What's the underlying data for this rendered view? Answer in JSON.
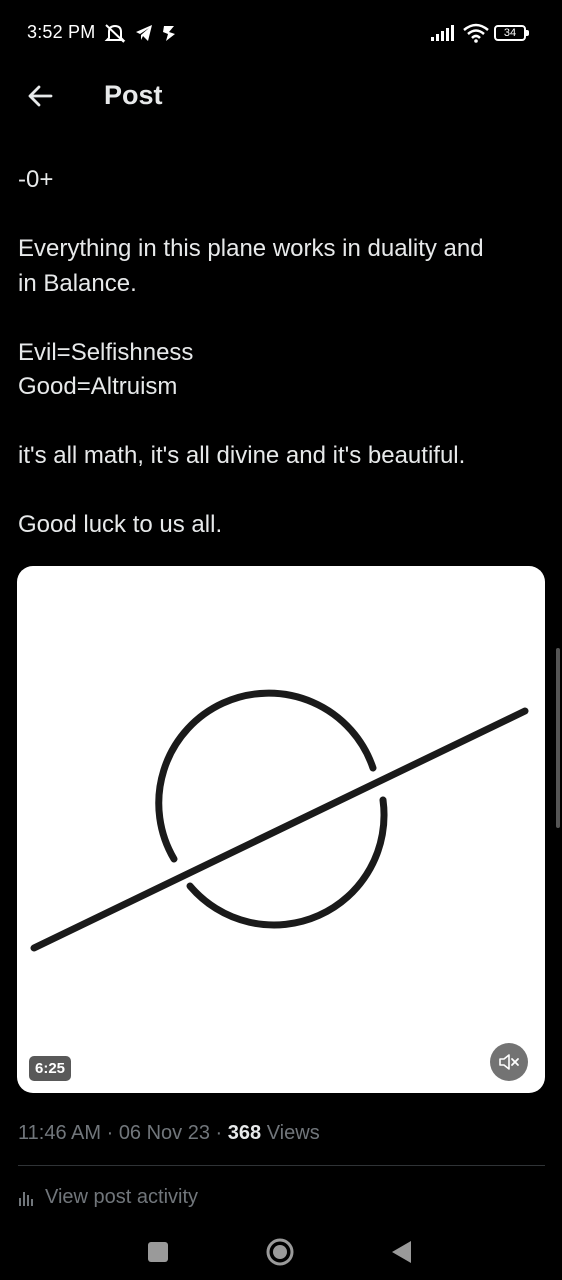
{
  "status_bar": {
    "time": "3:52 PM",
    "battery": "34",
    "icons": [
      "do-not-disturb-icon",
      "telegram-icon",
      "notification-icon",
      "signal-icon",
      "wifi-icon",
      "battery-icon"
    ]
  },
  "header": {
    "back_icon": "arrow-left-icon",
    "title": "Post"
  },
  "post": {
    "paragraphs": [
      [
        "-0+"
      ],
      [
        "Everything in this plane works in duality and",
        "in Balance."
      ],
      [
        "Evil=Selfishness",
        "Good=Altruism"
      ],
      [
        "it's all math, it's all divine and it's beautiful."
      ],
      [
        "Good luck to us all."
      ]
    ],
    "media": {
      "kind": "video",
      "duration": "6:25",
      "mute_icon": "speaker-muted-icon"
    },
    "meta": {
      "time": "11:46 AM",
      "separator": " · ",
      "date": "06 Nov 23",
      "views_count": "368",
      "views_label": "Views"
    },
    "activity": {
      "icon": "bar-chart-icon",
      "label": "View post activity"
    }
  },
  "nav_bar": {
    "buttons": [
      "recents-square-icon",
      "home-circle-icon",
      "back-triangle-icon"
    ]
  },
  "colors": {
    "background": "#000000",
    "text_primary": "#e7e9ea",
    "text_secondary": "#71767b",
    "divider": "#2f3336"
  }
}
